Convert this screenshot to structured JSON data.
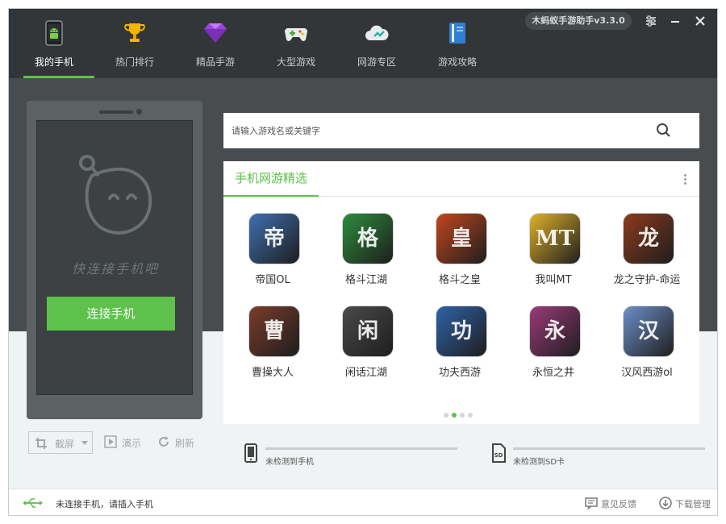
{
  "header": {
    "version": "木蚂蚁手游助手v3.3.0",
    "nav": [
      {
        "label": "我的手机",
        "icon": "android-phone-icon",
        "active": true
      },
      {
        "label": "热门排行",
        "icon": "trophy-icon",
        "active": false
      },
      {
        "label": "精品手游",
        "icon": "diamond-icon",
        "active": false
      },
      {
        "label": "大型游戏",
        "icon": "gamepad-icon",
        "active": false
      },
      {
        "label": "网游专区",
        "icon": "cloud-icon",
        "active": false
      },
      {
        "label": "游戏攻略",
        "icon": "guide-book-icon",
        "active": false
      }
    ]
  },
  "phone": {
    "tip": "快连接手机吧",
    "connect_label": "连接手机",
    "screenshot_label": "截屏",
    "demo_label": "演示",
    "refresh_label": "刷新"
  },
  "search": {
    "placeholder": "请输入游戏名或关键字",
    "value": ""
  },
  "games": {
    "title": "手机网游精选",
    "items": [
      {
        "name": "帝国OL",
        "color": "#3f6fb0"
      },
      {
        "name": "格斗江湖",
        "color": "#2d8c3c"
      },
      {
        "name": "格斗之皇",
        "color": "#c2461e"
      },
      {
        "name": "我叫MT",
        "color": "#e0b12a"
      },
      {
        "name": "龙之守护-命运",
        "color": "#8c3a1c"
      },
      {
        "name": "曹操大人",
        "color": "#7a3b2a"
      },
      {
        "name": "闲话江湖",
        "color": "#4a4a4a"
      },
      {
        "name": "功夫西游",
        "color": "#2f62a8"
      },
      {
        "name": "永恒之井",
        "color": "#9b3a7a"
      },
      {
        "name": "汉风西游ol",
        "color": "#6d8fc9"
      }
    ],
    "page_count": 4,
    "current_page": 2
  },
  "storage": {
    "phone_text": "未检测到手机",
    "sd_text": "未检测到SD卡"
  },
  "status": {
    "message": "未连接手机，请插入手机",
    "feedback_label": "意见反馈",
    "download_label": "下载管理"
  },
  "colors": {
    "accent": "#5dc14b",
    "header_bg": "#333638",
    "panel_dark": "#484c4f"
  }
}
